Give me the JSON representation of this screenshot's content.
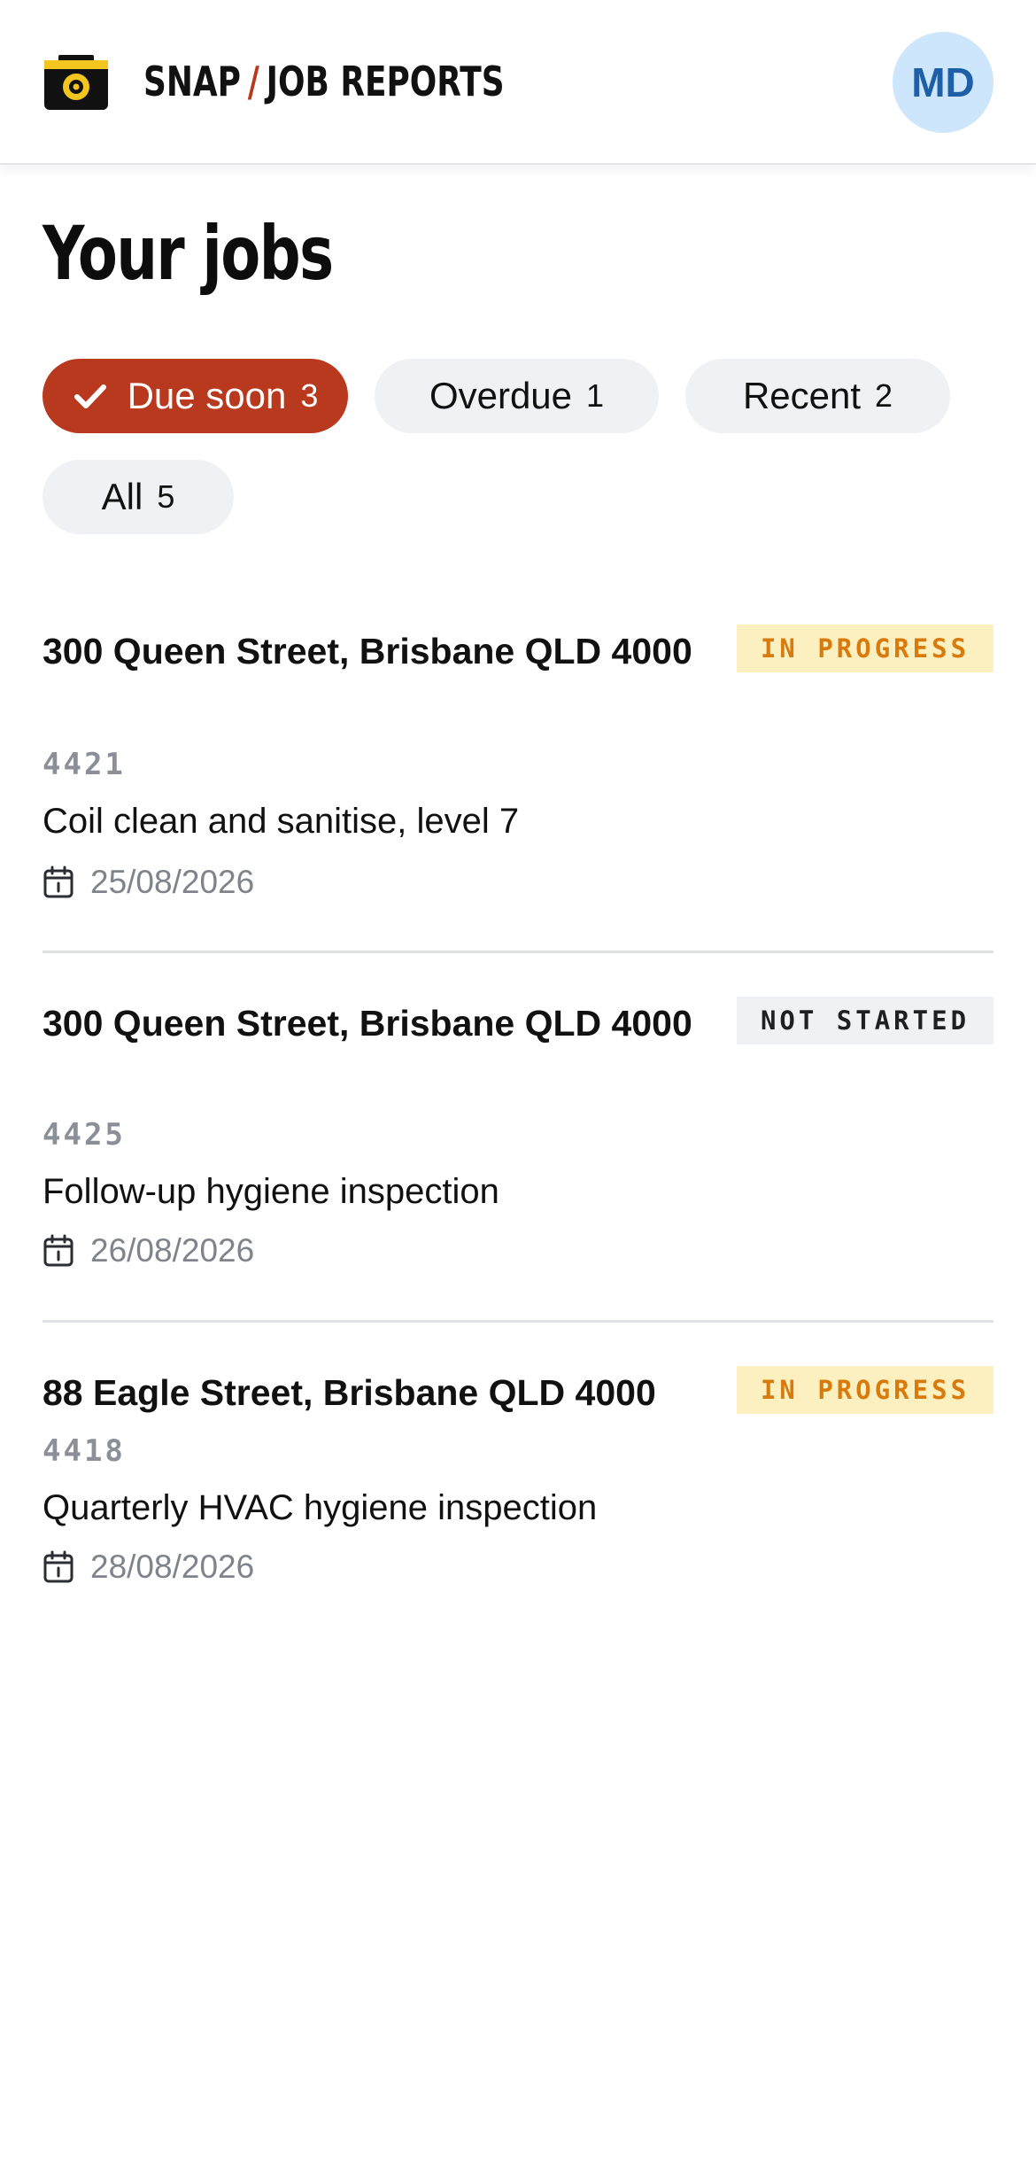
{
  "header": {
    "brand_left": "SNAP",
    "brand_slash": "/",
    "brand_right": "JOB REPORTS",
    "avatar_initials": "MD",
    "logo_icon": "camera-icon"
  },
  "page": {
    "title": "Your jobs"
  },
  "filters": [
    {
      "label": "Due soon",
      "count": "3",
      "active": true
    },
    {
      "label": "Overdue",
      "count": "1",
      "active": false
    },
    {
      "label": "Recent",
      "count": "2",
      "active": false
    },
    {
      "label": "All",
      "count": "5",
      "active": false
    }
  ],
  "jobs": [
    {
      "address": "300 Queen Street, Brisbane QLD 4000",
      "id": "4421",
      "description": "Coil clean and sanitise, level 7",
      "date": "25/08/2026",
      "status": "IN PROGRESS"
    },
    {
      "address": "300 Queen Street, Brisbane QLD 4000",
      "id": "4425",
      "description": "Follow-up hygiene inspection",
      "date": "26/08/2026",
      "status": "NOT STARTED"
    },
    {
      "address": "88 Eagle Street, Brisbane QLD 4000",
      "id": "4418",
      "description": "Quarterly HVAC hygiene inspection",
      "date": "28/08/2026",
      "status": "IN PROGRESS"
    }
  ],
  "colors": {
    "accent": "#b8391d",
    "avatar_bg": "#cde6fb",
    "avatar_text": "#1d5fa8",
    "in_progress_bg": "#fdf0c0",
    "in_progress_text": "#d97a0c",
    "not_started_bg": "#eff1f4"
  }
}
